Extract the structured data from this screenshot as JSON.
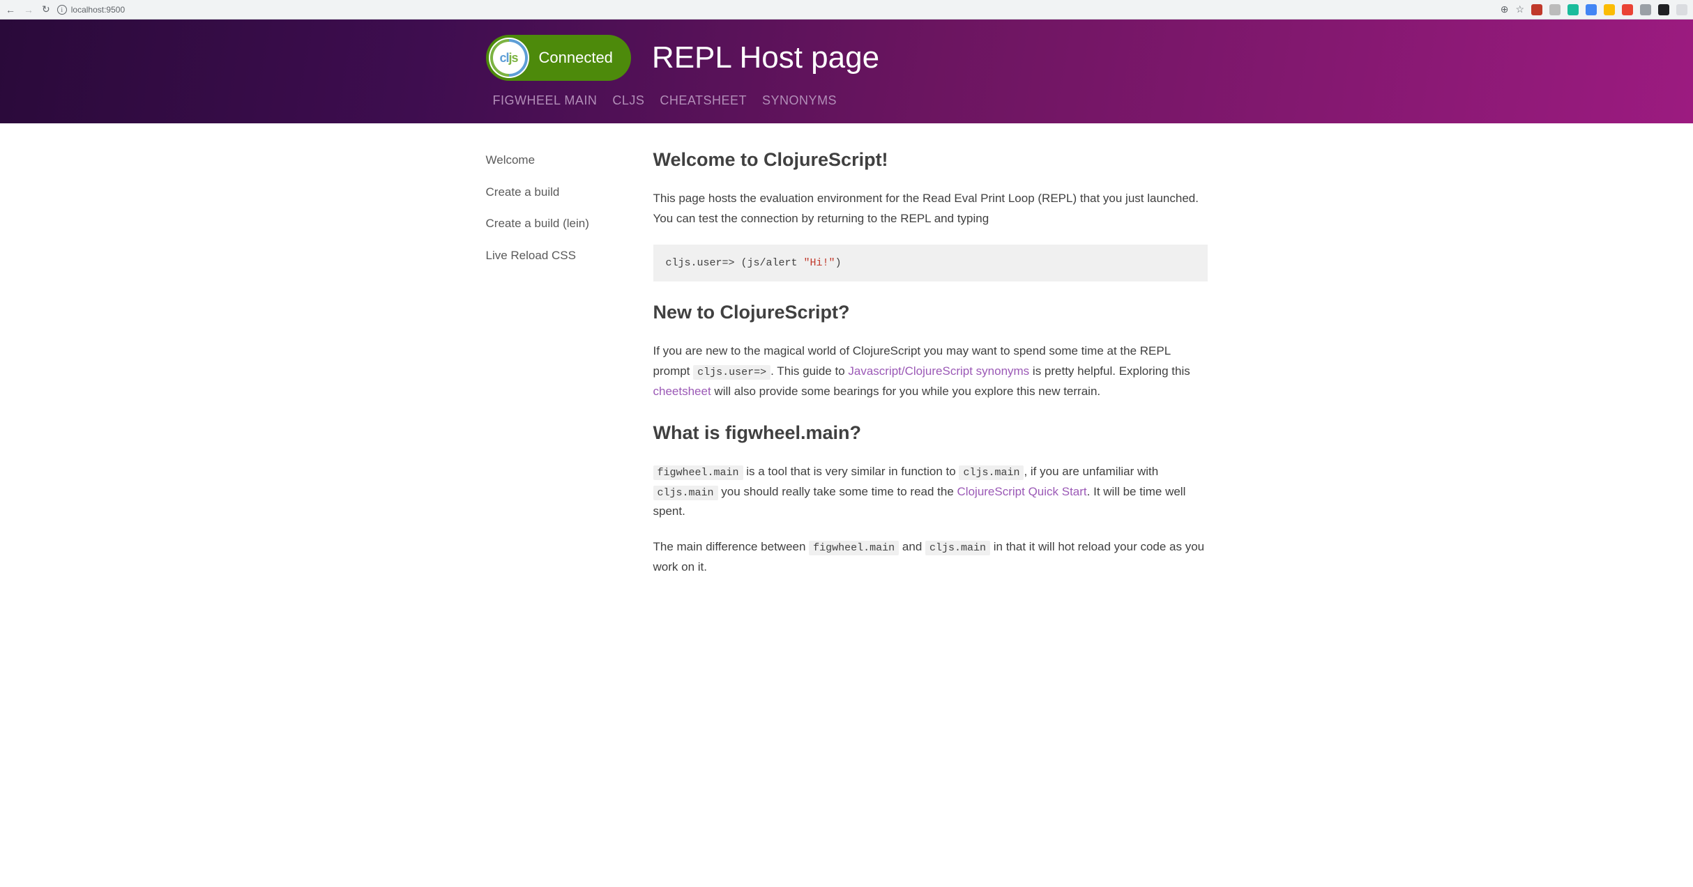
{
  "browser": {
    "url": "localhost:9500"
  },
  "header": {
    "badge_logo_c": "cl",
    "badge_logo_js": "js",
    "badge_status": "Connected",
    "title": "REPL Host page",
    "nav": [
      {
        "label": "FIGWHEEL MAIN"
      },
      {
        "label": "CLJS"
      },
      {
        "label": "CHEATSHEET"
      },
      {
        "label": "SYNONYMS"
      }
    ]
  },
  "sidebar": {
    "items": [
      {
        "label": "Welcome"
      },
      {
        "label": "Create a build"
      },
      {
        "label": "Create a build (lein)"
      },
      {
        "label": "Live Reload CSS"
      }
    ]
  },
  "content": {
    "h_welcome": "Welcome to ClojureScript!",
    "p_intro": "This page hosts the evaluation environment for the Read Eval Print Loop (REPL) that you just launched. You can test the connection by returning to the REPL and typing",
    "code_prefix": "cljs.user=> (js/alert ",
    "code_str": "\"Hi!\"",
    "code_suffix": ")",
    "h_new": "New to ClojureScript?",
    "new_text_1": "If you are new to the magical world of ClojureScript you may want to spend some time at the REPL prompt ",
    "new_code_1": "cljs.user=>",
    "new_text_2": ". This guide to ",
    "new_link_1": "Javascript/ClojureScript synonyms",
    "new_text_3": " is pretty helpful. Exploring this ",
    "new_link_2": "cheetsheet",
    "new_text_4": " will also provide some bearings for you while you explore this new terrain.",
    "h_what": "What is figwheel.main?",
    "what_code_1": "figwheel.main",
    "what_text_1": " is a tool that is very similar in function to ",
    "what_code_2": "cljs.main",
    "what_text_2": ", if you are unfamiliar with ",
    "what_code_3": "cljs.main",
    "what_text_3": " you should really take some time to read the ",
    "what_link_1": "ClojureScript Quick Start",
    "what_text_4": ". It will be time well spent.",
    "diff_text_1": "The main difference between ",
    "diff_code_1": "figwheel.main",
    "diff_text_2": " and ",
    "diff_code_2": "cljs.main",
    "diff_text_3": " in that it will hot reload your code as you work on it."
  }
}
